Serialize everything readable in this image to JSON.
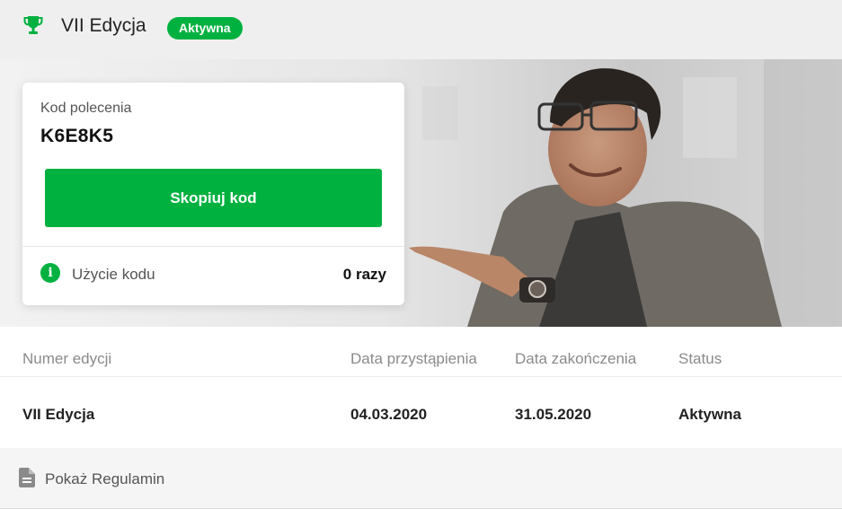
{
  "header": {
    "icon": "trophy-icon",
    "title": "VII Edycja",
    "status_badge": "Aktywna"
  },
  "colors": {
    "accent": "#00b140",
    "header_bg": "#efefef"
  },
  "referral_card": {
    "label": "Kod polecenia",
    "code": "K6E8K5",
    "copy_button": "Skopiuj kod",
    "usage_icon": "info-icon",
    "usage_label": "Użycie kodu",
    "usage_value": "0 razy"
  },
  "table": {
    "headers": [
      "Numer edycji",
      "Data przystąpienia",
      "Data zakończenia",
      "Status"
    ],
    "rows": [
      [
        "VII Edycja",
        "04.03.2020",
        "31.05.2020",
        "Aktywna"
      ]
    ]
  },
  "footer": {
    "icon": "document-icon",
    "link": "Pokaż Regulamin"
  }
}
